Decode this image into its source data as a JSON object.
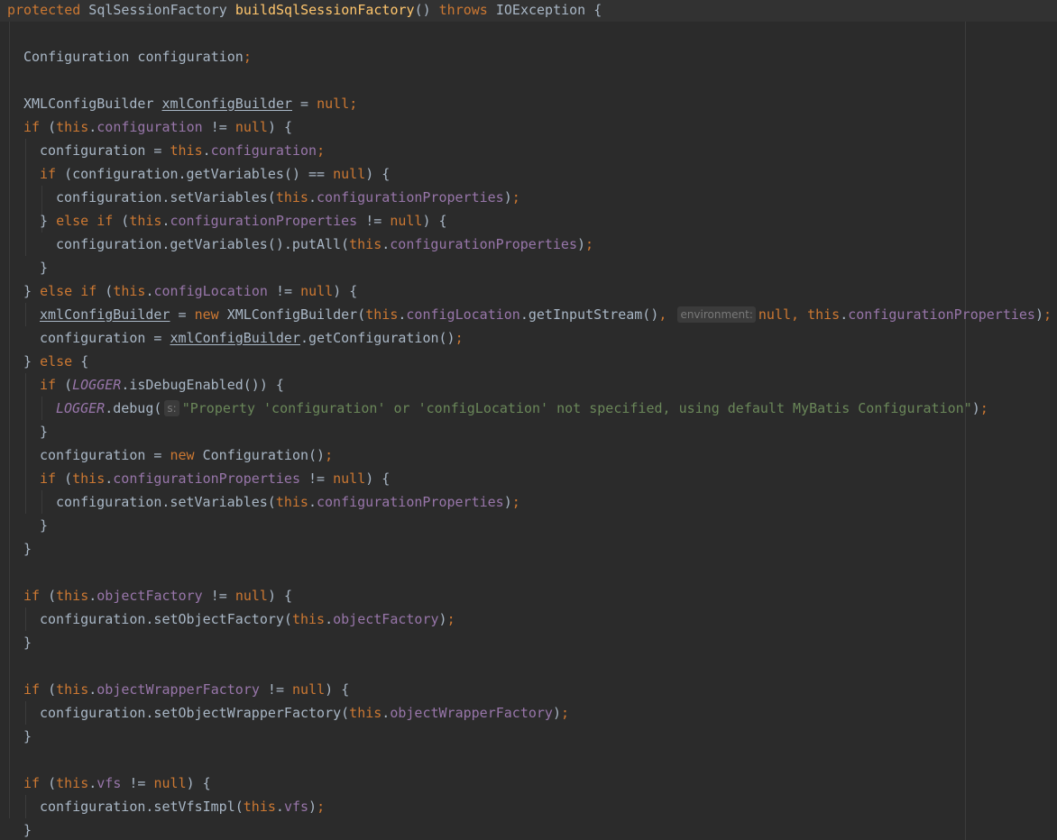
{
  "editor": {
    "theme_colors": {
      "background": "#2b2b2b",
      "keyword": "#cc7832",
      "plain": "#a9b7c6",
      "method_declaration": "#ffc66d",
      "field": "#9876aa",
      "string": "#6a8759",
      "inlay_hint": "#787878"
    },
    "lines": [
      {
        "indent": 0,
        "tokens": [
          [
            "kw",
            "protected"
          ],
          [
            "plain",
            " SqlSessionFactory "
          ],
          [
            "fn",
            "buildSqlSessionFactory"
          ],
          [
            "plain",
            "() "
          ],
          [
            "kw",
            "throws"
          ],
          [
            "plain",
            " IOException {"
          ]
        ]
      },
      {
        "indent": 0,
        "tokens": []
      },
      {
        "indent": 1,
        "tokens": [
          [
            "plain",
            "Configuration configuration"
          ],
          [
            "punct",
            ";"
          ]
        ]
      },
      {
        "indent": 0,
        "tokens": []
      },
      {
        "indent": 1,
        "tokens": [
          [
            "plain",
            "XMLConfigBuilder "
          ],
          [
            "var",
            "xmlConfigBuilder"
          ],
          [
            "plain",
            " = "
          ],
          [
            "kw",
            "null"
          ],
          [
            "punct",
            ";"
          ]
        ]
      },
      {
        "indent": 1,
        "tokens": [
          [
            "kw",
            "if"
          ],
          [
            "plain",
            " ("
          ],
          [
            "kw",
            "this"
          ],
          [
            "plain",
            "."
          ],
          [
            "field",
            "configuration"
          ],
          [
            "plain",
            " != "
          ],
          [
            "kw",
            "null"
          ],
          [
            "plain",
            ") {"
          ]
        ]
      },
      {
        "indent": 2,
        "tokens": [
          [
            "plain",
            "configuration = "
          ],
          [
            "kw",
            "this"
          ],
          [
            "plain",
            "."
          ],
          [
            "field",
            "configuration"
          ],
          [
            "punct",
            ";"
          ]
        ]
      },
      {
        "indent": 2,
        "tokens": [
          [
            "kw",
            "if"
          ],
          [
            "plain",
            " (configuration.getVariables() == "
          ],
          [
            "kw",
            "null"
          ],
          [
            "plain",
            ") {"
          ]
        ]
      },
      {
        "indent": 3,
        "tokens": [
          [
            "plain",
            "configuration.setVariables("
          ],
          [
            "kw",
            "this"
          ],
          [
            "plain",
            "."
          ],
          [
            "field",
            "configurationProperties"
          ],
          [
            "plain",
            ")"
          ],
          [
            "punct",
            ";"
          ]
        ]
      },
      {
        "indent": 2,
        "tokens": [
          [
            "plain",
            "} "
          ],
          [
            "kw",
            "else if"
          ],
          [
            "plain",
            " ("
          ],
          [
            "kw",
            "this"
          ],
          [
            "plain",
            "."
          ],
          [
            "field",
            "configurationProperties"
          ],
          [
            "plain",
            " != "
          ],
          [
            "kw",
            "null"
          ],
          [
            "plain",
            ") {"
          ]
        ]
      },
      {
        "indent": 3,
        "tokens": [
          [
            "plain",
            "configuration.getVariables().putAll("
          ],
          [
            "kw",
            "this"
          ],
          [
            "plain",
            "."
          ],
          [
            "field",
            "configurationProperties"
          ],
          [
            "plain",
            ")"
          ],
          [
            "punct",
            ";"
          ]
        ]
      },
      {
        "indent": 2,
        "tokens": [
          [
            "plain",
            "}"
          ]
        ]
      },
      {
        "indent": 1,
        "tokens": [
          [
            "plain",
            "} "
          ],
          [
            "kw",
            "else if"
          ],
          [
            "plain",
            " ("
          ],
          [
            "kw",
            "this"
          ],
          [
            "plain",
            "."
          ],
          [
            "field",
            "configLocation"
          ],
          [
            "plain",
            " != "
          ],
          [
            "kw",
            "null"
          ],
          [
            "plain",
            ") {"
          ]
        ]
      },
      {
        "indent": 2,
        "tokens": [
          [
            "var",
            "xmlConfigBuilder"
          ],
          [
            "plain",
            " = "
          ],
          [
            "kw",
            "new"
          ],
          [
            "plain",
            " XMLConfigBuilder("
          ],
          [
            "kw",
            "this"
          ],
          [
            "plain",
            "."
          ],
          [
            "field",
            "configLocation"
          ],
          [
            "plain",
            ".getInputStream()"
          ],
          [
            "punct",
            ", "
          ],
          [
            "hint",
            "environment:"
          ],
          [
            "kw",
            "null"
          ],
          [
            "punct",
            ", "
          ],
          [
            "kw",
            "this"
          ],
          [
            "plain",
            "."
          ],
          [
            "field",
            "configurationProperties"
          ],
          [
            "plain",
            ")"
          ],
          [
            "punct",
            ";"
          ]
        ]
      },
      {
        "indent": 2,
        "tokens": [
          [
            "plain",
            "configuration = "
          ],
          [
            "var",
            "xmlConfigBuilder"
          ],
          [
            "plain",
            ".getConfiguration()"
          ],
          [
            "punct",
            ";"
          ]
        ]
      },
      {
        "indent": 1,
        "tokens": [
          [
            "plain",
            "} "
          ],
          [
            "kw",
            "else"
          ],
          [
            "plain",
            " {"
          ]
        ]
      },
      {
        "indent": 2,
        "tokens": [
          [
            "kw",
            "if"
          ],
          [
            "plain",
            " ("
          ],
          [
            "const",
            "LOGGER"
          ],
          [
            "plain",
            ".isDebugEnabled()) {"
          ]
        ]
      },
      {
        "indent": 3,
        "tokens": [
          [
            "const",
            "LOGGER"
          ],
          [
            "plain",
            ".debug("
          ],
          [
            "hint",
            "s:"
          ],
          [
            "str",
            "\"Property 'configuration' or 'configLocation' not specified, using default MyBatis Configuration\""
          ],
          [
            "plain",
            ")"
          ],
          [
            "punct",
            ";"
          ]
        ]
      },
      {
        "indent": 2,
        "tokens": [
          [
            "plain",
            "}"
          ]
        ]
      },
      {
        "indent": 2,
        "tokens": [
          [
            "plain",
            "configuration = "
          ],
          [
            "kw",
            "new"
          ],
          [
            "plain",
            " Configuration()"
          ],
          [
            "punct",
            ";"
          ]
        ]
      },
      {
        "indent": 2,
        "tokens": [
          [
            "kw",
            "if"
          ],
          [
            "plain",
            " ("
          ],
          [
            "kw",
            "this"
          ],
          [
            "plain",
            "."
          ],
          [
            "field",
            "configurationProperties"
          ],
          [
            "plain",
            " != "
          ],
          [
            "kw",
            "null"
          ],
          [
            "plain",
            ") {"
          ]
        ]
      },
      {
        "indent": 3,
        "tokens": [
          [
            "plain",
            "configuration.setVariables("
          ],
          [
            "kw",
            "this"
          ],
          [
            "plain",
            "."
          ],
          [
            "field",
            "configurationProperties"
          ],
          [
            "plain",
            ")"
          ],
          [
            "punct",
            ";"
          ]
        ]
      },
      {
        "indent": 2,
        "tokens": [
          [
            "plain",
            "}"
          ]
        ]
      },
      {
        "indent": 1,
        "tokens": [
          [
            "plain",
            "}"
          ]
        ]
      },
      {
        "indent": 0,
        "tokens": []
      },
      {
        "indent": 1,
        "tokens": [
          [
            "kw",
            "if"
          ],
          [
            "plain",
            " ("
          ],
          [
            "kw",
            "this"
          ],
          [
            "plain",
            "."
          ],
          [
            "field",
            "objectFactory"
          ],
          [
            "plain",
            " != "
          ],
          [
            "kw",
            "null"
          ],
          [
            "plain",
            ") {"
          ]
        ]
      },
      {
        "indent": 2,
        "tokens": [
          [
            "plain",
            "configuration.setObjectFactory("
          ],
          [
            "kw",
            "this"
          ],
          [
            "plain",
            "."
          ],
          [
            "field",
            "objectFactory"
          ],
          [
            "plain",
            ")"
          ],
          [
            "punct",
            ";"
          ]
        ]
      },
      {
        "indent": 1,
        "tokens": [
          [
            "plain",
            "}"
          ]
        ]
      },
      {
        "indent": 0,
        "tokens": []
      },
      {
        "indent": 1,
        "tokens": [
          [
            "kw",
            "if"
          ],
          [
            "plain",
            " ("
          ],
          [
            "kw",
            "this"
          ],
          [
            "plain",
            "."
          ],
          [
            "field",
            "objectWrapperFactory"
          ],
          [
            "plain",
            " != "
          ],
          [
            "kw",
            "null"
          ],
          [
            "plain",
            ") {"
          ]
        ]
      },
      {
        "indent": 2,
        "tokens": [
          [
            "plain",
            "configuration.setObjectWrapperFactory("
          ],
          [
            "kw",
            "this"
          ],
          [
            "plain",
            "."
          ],
          [
            "field",
            "objectWrapperFactory"
          ],
          [
            "plain",
            ")"
          ],
          [
            "punct",
            ";"
          ]
        ]
      },
      {
        "indent": 1,
        "tokens": [
          [
            "plain",
            "}"
          ]
        ]
      },
      {
        "indent": 0,
        "tokens": []
      },
      {
        "indent": 1,
        "tokens": [
          [
            "kw",
            "if"
          ],
          [
            "plain",
            " ("
          ],
          [
            "kw",
            "this"
          ],
          [
            "plain",
            "."
          ],
          [
            "field",
            "vfs"
          ],
          [
            "plain",
            " != "
          ],
          [
            "kw",
            "null"
          ],
          [
            "plain",
            ") {"
          ]
        ]
      },
      {
        "indent": 2,
        "tokens": [
          [
            "plain",
            "configuration.setVfsImpl("
          ],
          [
            "kw",
            "this"
          ],
          [
            "plain",
            "."
          ],
          [
            "field",
            "vfs"
          ],
          [
            "plain",
            ")"
          ],
          [
            "punct",
            ";"
          ]
        ]
      },
      {
        "indent": 1,
        "tokens": [
          [
            "plain",
            "}"
          ]
        ]
      }
    ]
  }
}
